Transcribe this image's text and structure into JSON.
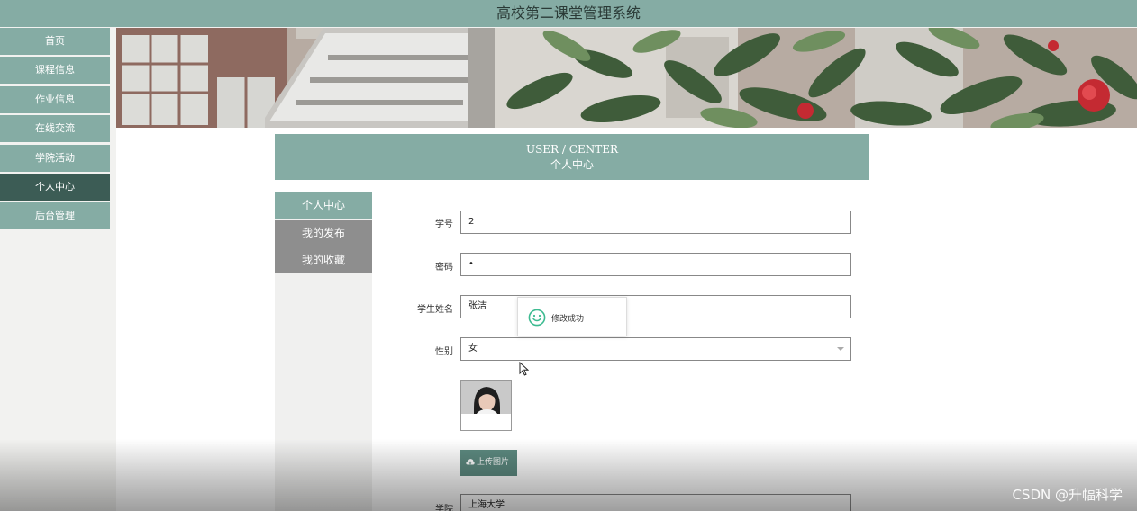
{
  "app": {
    "title": "高校第二课堂管理系统"
  },
  "sidebar": {
    "items": [
      {
        "label": "首页"
      },
      {
        "label": "课程信息"
      },
      {
        "label": "作业信息"
      },
      {
        "label": "在线交流"
      },
      {
        "label": "学院活动"
      },
      {
        "label": "个人中心"
      },
      {
        "label": "后台管理"
      }
    ],
    "active_label": "个人中心"
  },
  "user_center": {
    "title_en": "USER / CENTER",
    "title_cn": "个人中心",
    "nav": [
      {
        "label": "个人中心"
      },
      {
        "label": "我的发布"
      },
      {
        "label": "我的收藏"
      }
    ],
    "active_nav": "个人中心"
  },
  "form": {
    "student_id": {
      "label": "学号",
      "value": "2"
    },
    "password": {
      "label": "密码",
      "value": "•"
    },
    "student_name": {
      "label": "学生姓名",
      "value": "张洁"
    },
    "gender": {
      "label": "性别",
      "value": "女"
    },
    "upload_label": "上传图片",
    "college": {
      "label": "学院",
      "value": "上海大学"
    }
  },
  "toast": {
    "message": "修改成功",
    "icon": "smile-icon"
  },
  "watermark": "CSDN @升幅科学",
  "colors": {
    "accent": "#85aca4",
    "active_dark": "#3c5c55",
    "tab_gray": "#8e8e8e",
    "button": "#5d8a80"
  }
}
